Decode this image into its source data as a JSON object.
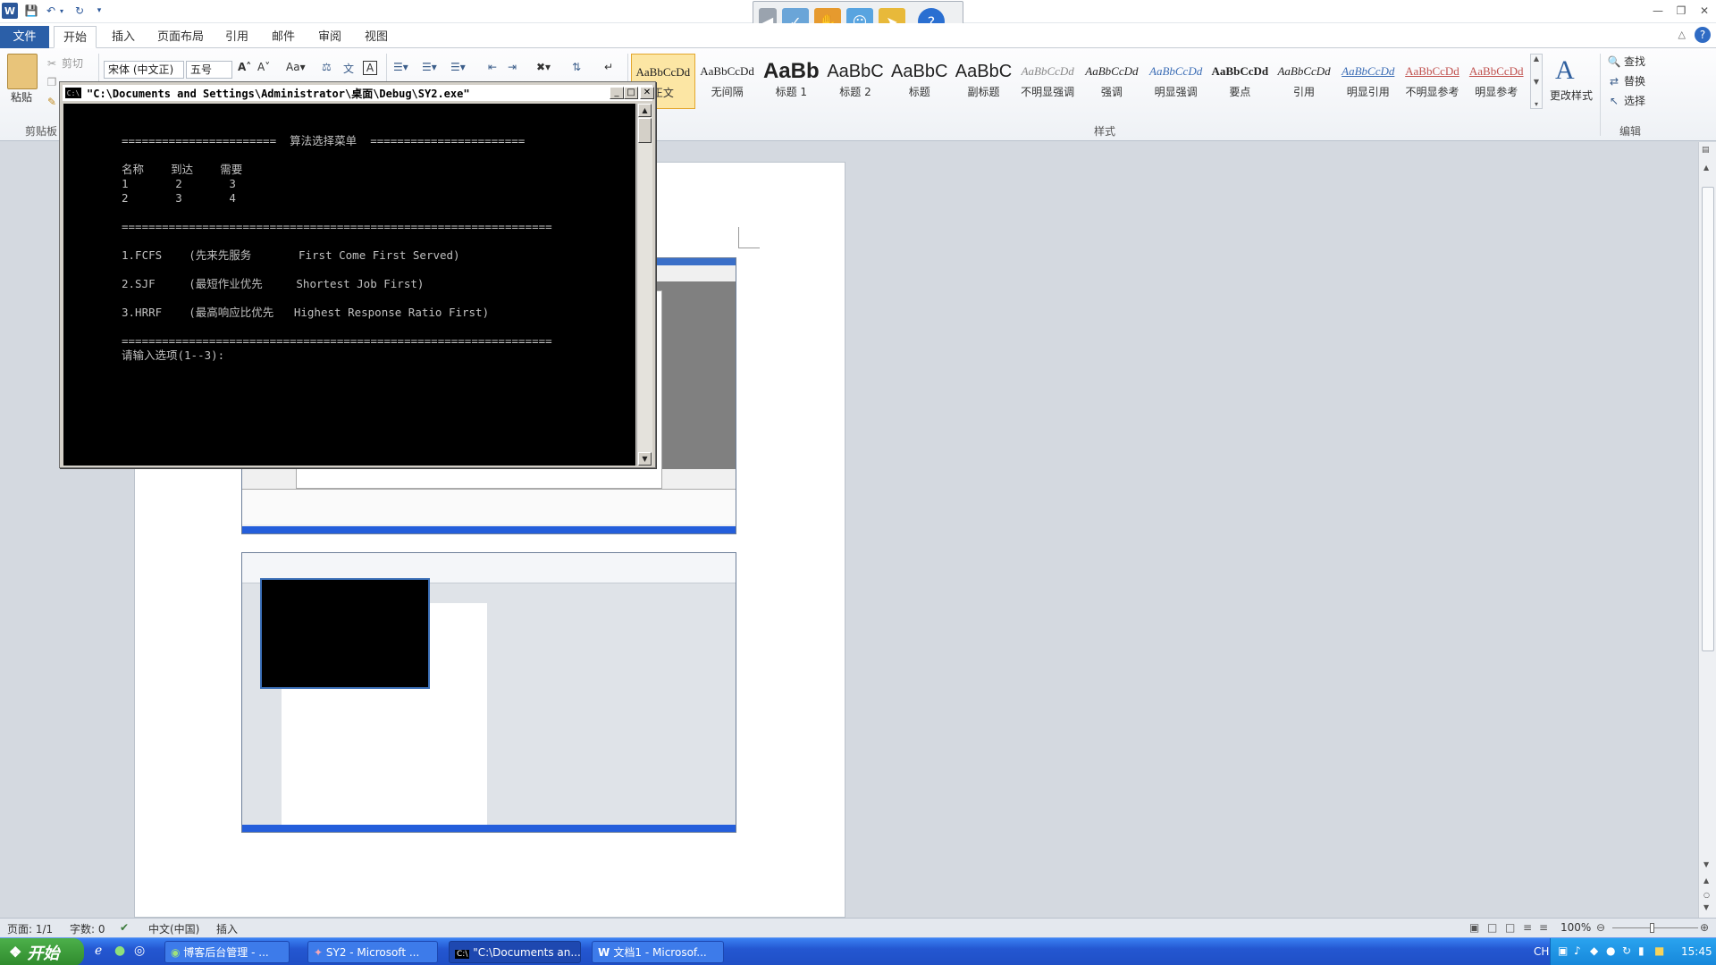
{
  "window": {
    "logo": "W"
  },
  "tabs": [
    {
      "label": "文件"
    },
    {
      "label": "开始"
    },
    {
      "label": "插入"
    },
    {
      "label": "页面布局"
    },
    {
      "label": "引用"
    },
    {
      "label": "邮件"
    },
    {
      "label": "审阅"
    },
    {
      "label": "视图"
    }
  ],
  "ribbon": {
    "clipboard": {
      "paste": "粘贴",
      "cut": "剪切",
      "group": "剪贴板"
    },
    "font": {
      "family": "宋体 (中文正)",
      "size": "五号"
    },
    "styles": {
      "group": "样式",
      "items": [
        {
          "sample": "AaBbCcDd",
          "name": "正文"
        },
        {
          "sample": "AaBbCcDd",
          "name": "无间隔"
        },
        {
          "sample": "AaBb",
          "name": "标题 1"
        },
        {
          "sample": "AaBbC",
          "name": "标题 2"
        },
        {
          "sample": "AaBbC",
          "name": "标题"
        },
        {
          "sample": "AaBbC",
          "name": "副标题"
        },
        {
          "sample": "AaBbCcDd",
          "name": "不明显强调"
        },
        {
          "sample": "AaBbCcDd",
          "name": "强调"
        },
        {
          "sample": "AaBbCcDd",
          "name": "明显强调"
        },
        {
          "sample": "AaBbCcDd",
          "name": "要点"
        },
        {
          "sample": "AaBbCcDd",
          "name": "引用"
        },
        {
          "sample": "AaBbCcDd",
          "name": "明显引用"
        },
        {
          "sample": "AaBbCcDd",
          "name": "不明显参考"
        },
        {
          "sample": "AaBbCcDd",
          "name": "明显参考"
        }
      ],
      "change": "更改样式"
    },
    "editing": {
      "find": "查找",
      "replace": "替换",
      "select": "选择",
      "group": "编辑"
    }
  },
  "console": {
    "title": "\"C:\\Documents and Settings\\Administrator\\桌面\\Debug\\SY2.exe\"",
    "lines": [
      "=======================  算法选择菜单  =======================",
      "名称    到达    需要",
      "1       2       3",
      "2       3       4",
      "================================================================",
      "1.FCFS    (先来先服务       First Come First Served)",
      "2.SJF     (最短作业优先     Shortest Job First)",
      "3.HRRF    (最高响应比优先   Highest Response Ratio First)",
      "================================================================",
      "请输入选项(1--3):"
    ]
  },
  "status": {
    "page": "页面: 1/1",
    "words": "字数: 0",
    "lang": "中文(中国)",
    "mode": "插入",
    "zoom": "100%"
  },
  "taskbar": {
    "start": "开始",
    "tasks": [
      {
        "label": "博客后台管理 - ..."
      },
      {
        "label": "SY2 - Microsoft ..."
      },
      {
        "label": "\"C:\\Documents an..."
      },
      {
        "label": "文档1 - Microsof..."
      }
    ],
    "lang": "CH",
    "time": "15:45"
  },
  "colors": {
    "accent": "#2b579a",
    "taskbar": "#245edb",
    "start": "#3c9a3a"
  }
}
